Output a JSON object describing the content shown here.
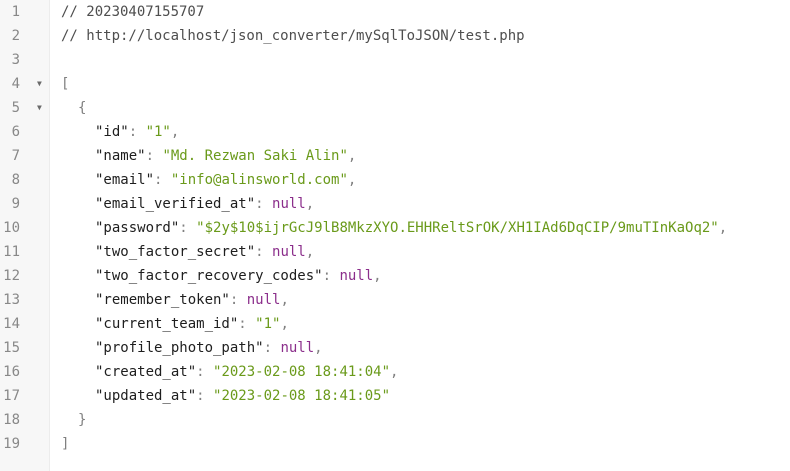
{
  "gutter": {
    "line_numbers": [
      "1",
      "2",
      "3",
      "4",
      "5",
      "6",
      "7",
      "8",
      "9",
      "10",
      "11",
      "12",
      "13",
      "14",
      "15",
      "16",
      "17",
      "18",
      "19"
    ],
    "fold_icon": "triangle-down"
  },
  "code": {
    "comment_timestamp": "// 20230407155707",
    "comment_url": "// http://localhost/json_converter/mySqlToJSON/test.php",
    "open_bracket": "[",
    "open_brace": "{",
    "close_brace": "}",
    "close_bracket": "]",
    "fields": [
      {
        "key": "\"id\"",
        "value": "\"1\"",
        "type": "string"
      },
      {
        "key": "\"name\"",
        "value": "\"Md. Rezwan Saki Alin\"",
        "type": "string"
      },
      {
        "key": "\"email\"",
        "value": "\"info@alinsworld.com\"",
        "type": "string"
      },
      {
        "key": "\"email_verified_at\"",
        "value": "null",
        "type": "null"
      },
      {
        "key": "\"password\"",
        "value": "\"$2y$10$ijrGcJ9lB8MkzXYO.EHHReltSrOK/XH1IAd6DqCIP/9muTInKaOq2\"",
        "type": "string"
      },
      {
        "key": "\"two_factor_secret\"",
        "value": "null",
        "type": "null"
      },
      {
        "key": "\"two_factor_recovery_codes\"",
        "value": "null",
        "type": "null"
      },
      {
        "key": "\"remember_token\"",
        "value": "null",
        "type": "null"
      },
      {
        "key": "\"current_team_id\"",
        "value": "\"1\"",
        "type": "string"
      },
      {
        "key": "\"profile_photo_path\"",
        "value": "null",
        "type": "null"
      },
      {
        "key": "\"created_at\"",
        "value": "\"2023-02-08 18:41:04\"",
        "type": "string"
      },
      {
        "key": "\"updated_at\"",
        "value": "\"2023-02-08 18:41:05\"",
        "type": "string"
      }
    ]
  },
  "colors": {
    "string": "#6a9a1a",
    "null": "#8b2e8b",
    "comment": "#4e4e4e",
    "gutter_bg": "#f7f7f7"
  }
}
